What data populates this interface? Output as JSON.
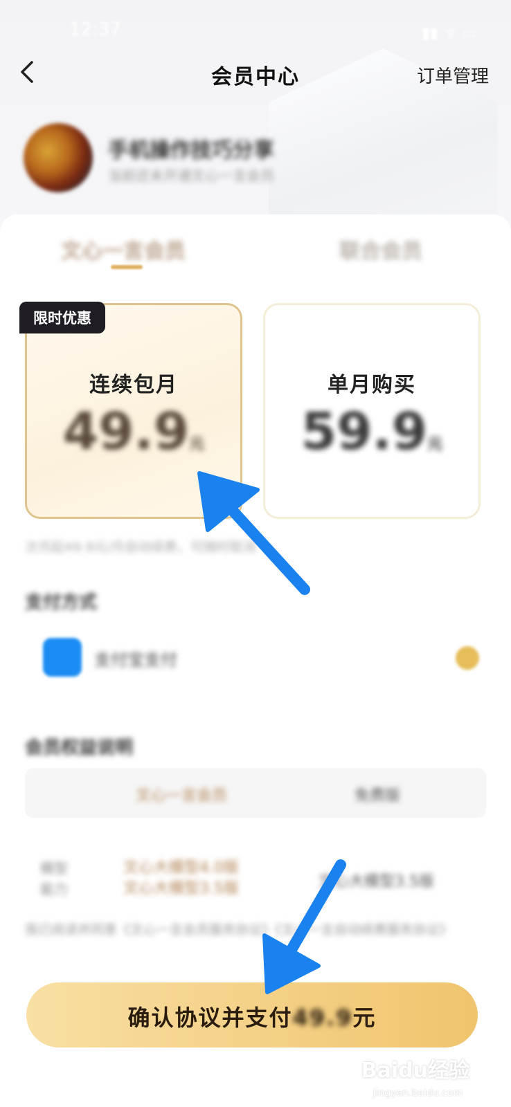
{
  "status": {
    "time": "12:37",
    "icons": "▮▮ ᯤ ▭"
  },
  "nav": {
    "title": "会员中心",
    "order_link": "订单管理"
  },
  "profile": {
    "name": "手机操作技巧分享",
    "subtitle": "当前还未开通文心一言会员"
  },
  "tabs": [
    {
      "label": "文心一言会员"
    },
    {
      "label": "联合会员"
    }
  ],
  "plans": [
    {
      "name": "连续包月",
      "price": "49.9",
      "unit": "元",
      "badge": "限时优惠",
      "selected": true
    },
    {
      "name": "单月购买",
      "price": "59.9",
      "unit": "元",
      "selected": false
    }
  ],
  "plan_note": "次月起49.9元/月自动续费，可随时取消",
  "payment": {
    "section_title": "支付方式",
    "method": "支付宝支付"
  },
  "benefits": {
    "section_title": "会员权益说明",
    "headers": [
      "文心一言会员",
      "免费版"
    ],
    "row_label_1": "模型",
    "row_label_2": "能力",
    "member_line_1": "文心大模型4.0版",
    "member_line_2": "文心大模型3.5版",
    "free_value": "文心大模型3.5版"
  },
  "agreement": "我已阅读并同意《文心一言会员服务协议》《文心一言自动续费服务协议》",
  "pay_button": {
    "label": "确认协议并支付",
    "amount": "49.9",
    "unit": "元"
  },
  "watermark": {
    "main": "Baidu经验",
    "sub": "jingyan.baidu.com"
  },
  "colors": {
    "accent": "#f0c46d",
    "arrow": "#1a82ef",
    "badge_bg": "#1f1c24"
  }
}
